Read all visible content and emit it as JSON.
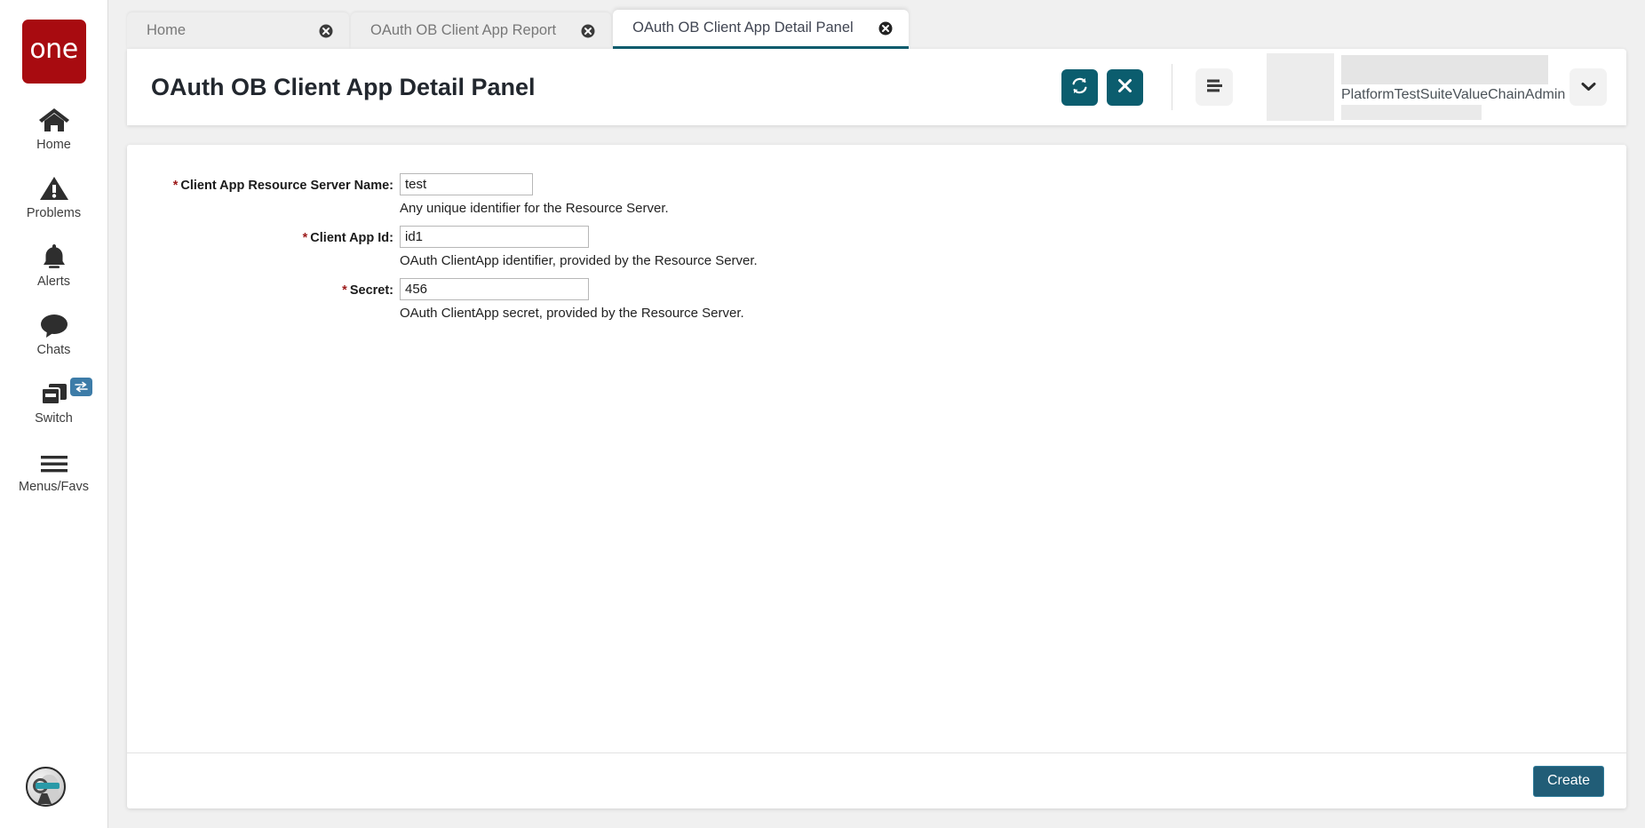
{
  "app": {
    "logo_text": "one",
    "brand_color": "#a80b10",
    "accent_color": "#0b5d6e",
    "create_button_color": "#215d77",
    "active_tab_underline_color": "#0b5d6e"
  },
  "sidebar": {
    "items": [
      {
        "label": "Home",
        "icon": "home-icon"
      },
      {
        "label": "Problems",
        "icon": "warning-triangle-icon"
      },
      {
        "label": "Alerts",
        "icon": "bell-icon"
      },
      {
        "label": "Chats",
        "icon": "chat-bubble-icon"
      },
      {
        "label": "Switch",
        "icon": "windows-stack-icon",
        "badge_icon": "swap-arrows-icon"
      },
      {
        "label": "Menus/Favs",
        "icon": "hamburger-icon"
      }
    ],
    "avatar": {
      "icon": "robot-avatar-icon"
    }
  },
  "tabs": [
    {
      "label": "Home",
      "active": false,
      "close_icon": "close-circle-icon"
    },
    {
      "label": "OAuth OB Client App Report",
      "active": false,
      "close_icon": "close-circle-icon"
    },
    {
      "label": "OAuth OB Client App Detail Panel",
      "active": true,
      "close_icon": "close-circle-icon"
    }
  ],
  "header": {
    "title": "OAuth OB Client App Detail Panel",
    "refresh_button": {
      "icon": "refresh-icon",
      "label": ""
    },
    "close_button": {
      "icon": "x-icon",
      "label": ""
    },
    "menu_button": {
      "icon": "hamburger-icon",
      "label": ""
    },
    "username": "PlatformTestSuiteValueChainAdmin",
    "user_dropdown": {
      "icon": "chevron-down-icon",
      "label": ""
    }
  },
  "form": {
    "fields": [
      {
        "label": "Client App Resource Server Name:",
        "required": true,
        "value": "test",
        "placeholder": "",
        "hint": "Any unique identifier for the Resource Server.",
        "input_width": 150
      },
      {
        "label": "Client App Id:",
        "required": true,
        "value": "id1",
        "placeholder": "",
        "hint": "OAuth ClientApp identifier, provided by the Resource Server.",
        "input_width": 213
      },
      {
        "label": "Secret:",
        "required": true,
        "value": "456",
        "placeholder": "",
        "hint": "OAuth ClientApp secret, provided by the Resource Server.",
        "input_width": 213
      }
    ]
  },
  "footer": {
    "create_label": "Create"
  }
}
